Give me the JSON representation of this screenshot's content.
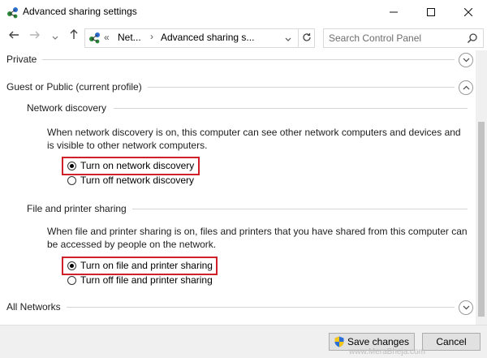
{
  "window": {
    "title": "Advanced sharing settings",
    "minimize_icon": "minimize-icon",
    "maximize_icon": "maximize-icon",
    "close_icon": "close-icon"
  },
  "nav": {
    "breadcrumb_overflow": "«",
    "breadcrumb_parent": "Net...",
    "breadcrumb_current": "Advanced sharing s...",
    "separator": "›",
    "search_placeholder": "Search Control Panel"
  },
  "sections": {
    "private": {
      "label": "Private"
    },
    "guest": {
      "label": "Guest or Public (current profile)",
      "network_discovery": {
        "heading": "Network discovery",
        "description": "When network discovery is on, this computer can see other network computers and devices and is visible to other network computers.",
        "option_on": "Turn on network discovery",
        "option_off": "Turn off network discovery",
        "selected": "on"
      },
      "file_sharing": {
        "heading": "File and printer sharing",
        "description": "When file and printer sharing is on, files and printers that you have shared from this computer can be accessed by people on the network.",
        "option_on": "Turn on file and printer sharing",
        "option_off": "Turn off file and printer sharing",
        "selected": "on"
      }
    },
    "all_networks": {
      "label": "All Networks"
    }
  },
  "footer": {
    "save_label": "Save changes",
    "cancel_label": "Cancel",
    "watermark": "www.MeraBheja.com"
  },
  "colors": {
    "highlight_box": "#d0202a",
    "shield_blue": "#2b6fd6",
    "shield_yellow": "#f5c518"
  }
}
